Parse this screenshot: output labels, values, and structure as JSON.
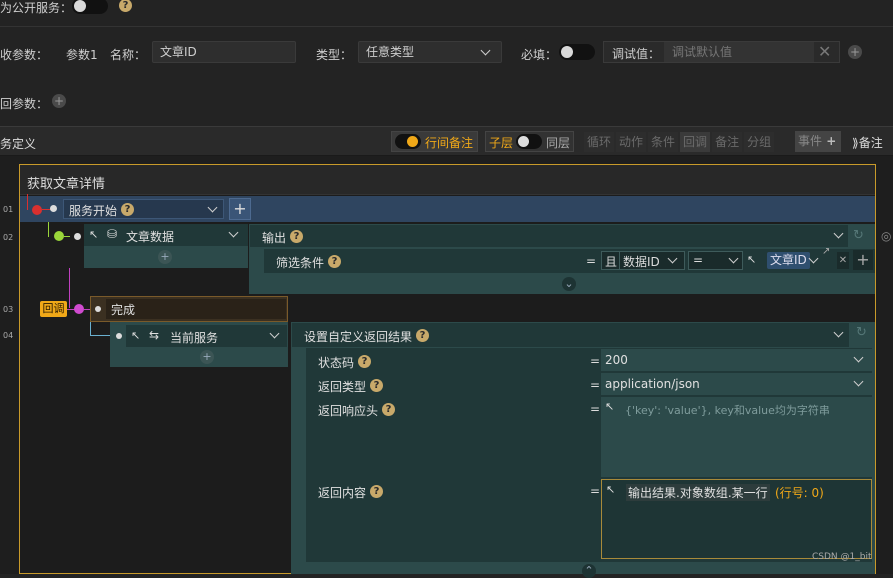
{
  "top": {
    "public_label": "为公开服务：",
    "params_label": "收参数：",
    "param1_label": "参数1",
    "name_label": "名称：",
    "name_value": "文章ID",
    "type_label": "类型：",
    "type_value": "任意类型",
    "required_label": "必填：",
    "debug_label": "调试值：",
    "debug_placeholder": "调试默认值",
    "return_label": "回参数："
  },
  "toolbar": {
    "title": "务定义",
    "row_note": "行间备注",
    "child_layer": "子层",
    "same_layer": "同层",
    "loop": "循环",
    "action": "动作",
    "condition": "条件",
    "callback": "回调",
    "note": "备注",
    "branch": "分组",
    "event": "事件",
    "note_right": "备注"
  },
  "flow": {
    "title": "获取文章详情",
    "row_numbers": [
      "01",
      "02",
      "03",
      "04"
    ],
    "start": "服务开始",
    "article_data": "文章数据",
    "output": "输出",
    "filter": "筛选条件",
    "and": "且",
    "field": "数据ID",
    "op": "=",
    "value": "文章ID",
    "callback_tag": "回调",
    "done": "完成",
    "current_service": "当前服务",
    "set_return": "设置自定义返回结果",
    "status_code_label": "状态码",
    "status_code_value": "200",
    "return_type_label": "返回类型",
    "return_type_value": "application/json",
    "headers_label": "返回响应头",
    "headers_placeholder": "{'key': 'value'}, key和value均为字符串",
    "content_label": "返回内容",
    "content_value": "输出结果.对象数组.某一行",
    "content_row": "(行号: 0)",
    "eq": "="
  },
  "watermark": "CSDN @1_bit",
  "colors": {
    "accent": "#f0a818",
    "start_row": "#2f4560",
    "teal": "#2c4a4a"
  }
}
